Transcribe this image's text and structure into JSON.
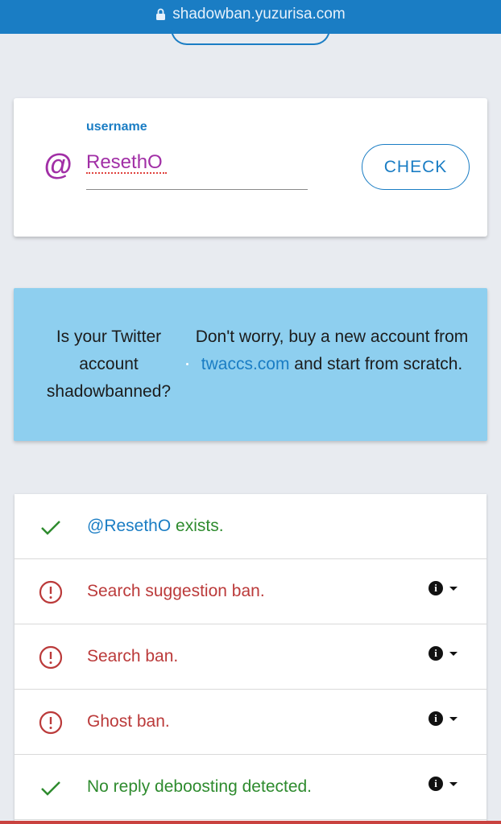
{
  "browser": {
    "url": "shadowban.yuzurisa.com",
    "lock_icon": "lock-icon"
  },
  "search": {
    "at_symbol": "@",
    "label": "username",
    "value": "ResethO",
    "button_label": "CHECK"
  },
  "ad": {
    "left_text": "Is your Twitter account shadowbanned?",
    "right_text_before": "Don't worry, buy a new account from ",
    "right_link": "twaccs.com",
    "right_text_after": " and start from scratch."
  },
  "results": [
    {
      "status": "ok",
      "icon": "check-icon",
      "handle": "@ResethO",
      "text": " exists.",
      "has_info": false
    },
    {
      "status": "bad",
      "icon": "alert-circle-icon",
      "text": "Search suggestion ban.",
      "has_info": true
    },
    {
      "status": "bad",
      "icon": "alert-circle-icon",
      "text": "Search ban.",
      "has_info": true
    },
    {
      "status": "bad",
      "icon": "alert-circle-icon",
      "text": "Ghost ban.",
      "has_info": true
    },
    {
      "status": "ok",
      "icon": "check-icon",
      "text": "No reply deboosting detected.",
      "has_info": true
    }
  ],
  "colors": {
    "header": "#1a7dc4",
    "accent_purple": "#a12fa6",
    "ok_green": "#2e8b2e",
    "ban_red": "#bb3a3a",
    "ad_bg": "#8ecfef",
    "page_bg": "#e8ebf0"
  }
}
